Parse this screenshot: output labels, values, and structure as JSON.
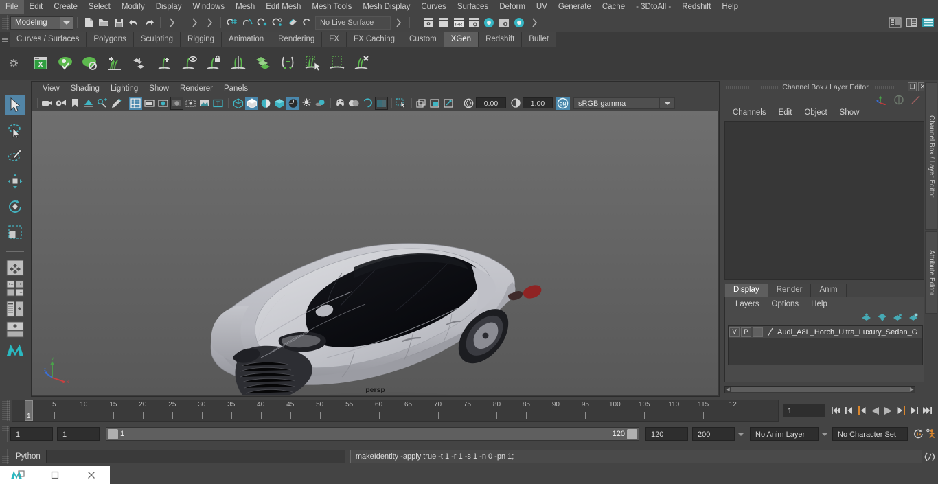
{
  "app": {
    "menubar": [
      "File",
      "Edit",
      "Create",
      "Select",
      "Modify",
      "Display",
      "Windows",
      "Mesh",
      "Edit Mesh",
      "Mesh Tools",
      "Mesh Display",
      "Curves",
      "Surfaces",
      "Deform",
      "UV",
      "Generate",
      "Cache",
      "- 3DtoAll -",
      "Redshift",
      "Help"
    ]
  },
  "statusline": {
    "menuset_value": "Modeling",
    "live_surface": "No Live Surface"
  },
  "shelf": {
    "tabs": [
      "Curves / Surfaces",
      "Polygons",
      "Sculpting",
      "Rigging",
      "Animation",
      "Rendering",
      "FX",
      "FX Caching",
      "Custom",
      "XGen",
      "Redshift",
      "Bullet"
    ],
    "active_tab": "XGen",
    "icons": [
      "xgen-editor-icon",
      "xgen-preview-visible-icon",
      "xgen-preview-disable-icon",
      "xgen-add-collection-icon",
      "xgen-import-description-icon",
      "xgen-add-description-icon",
      "xgen-preview-description-icon",
      "xgen-lock-description-icon",
      "xgen-mirror-description-icon",
      "xgen-duplicate-description-icon",
      "xgen-transfer-icon",
      "xgen-select-primitives-icon",
      "xgen-select-region-icon",
      "xgen-clear-region-icon",
      "xgen-delete-primitives-icon"
    ]
  },
  "toolbox": {
    "tools": [
      {
        "name": "select-tool",
        "selected": true
      },
      {
        "name": "lasso-select-tool",
        "selected": false
      },
      {
        "name": "paint-select-tool",
        "selected": false
      },
      {
        "name": "move-tool",
        "selected": false
      },
      {
        "name": "rotate-tool",
        "selected": false
      },
      {
        "name": "scale-tool",
        "selected": false
      }
    ],
    "layouts": [
      "single-perspective-layout",
      "four-view-layout",
      "outliner-persp-layout",
      "hypershade-persp-layout",
      "maya-logo-icon"
    ]
  },
  "viewport": {
    "menus": [
      "View",
      "Shading",
      "Lighting",
      "Show",
      "Renderer",
      "Panels"
    ],
    "exposure_value": "0.00",
    "gamma_value": "1.00",
    "color_management": "sRGB gamma",
    "color_management_toggle": "ON",
    "camera_label": "persp",
    "axis_labels": {
      "x": "x",
      "y": "y",
      "z": "z"
    },
    "toolbar_icons": [
      "select-camera-icon",
      "camera-attributes-icon",
      "bookmark-icon",
      "image-plane-icon",
      "2d-pan-zoom-icon",
      "grease-pencil-icon",
      "grid-toggle-icon",
      "film-gate-icon",
      "resolution-gate-icon",
      "gate-mask-icon",
      "film-origin-icon",
      "exposure-icon",
      "text-icon",
      "wireframe-icon",
      "smooth-shade-icon",
      "shaded-wireframe-icon",
      "flat-shade-icon",
      "textured-icon",
      "lights-icon",
      "shadows-icon",
      "screen-space-ao-icon",
      "motion-blur-icon",
      "multisample-icon",
      "depth-of-field-icon",
      "xray-icon",
      "xray-joints-icon",
      "xray-active-icon",
      "isolate-select-icon",
      "no-isolate-icon",
      "exposure-aperture-icon",
      "contrast-icon"
    ]
  },
  "channelbox": {
    "panel_title": "Channel Box / Layer Editor",
    "menus": [
      "Channels",
      "Edit",
      "Object",
      "Show"
    ],
    "layer_tabs": [
      "Display",
      "Render",
      "Anim"
    ],
    "active_layer_tab": "Display",
    "layer_menus": [
      "Layers",
      "Options",
      "Help"
    ],
    "layers": [
      {
        "visibility": "V",
        "playback": "P",
        "name": "Audi_A8L_Horch_Ultra_Luxury_Sedan_G"
      }
    ]
  },
  "vertical_tabs": [
    "Channel Box / Layer Editor",
    "Attribute Editor"
  ],
  "timeline": {
    "start": 1,
    "end": 120,
    "current_frame": "1",
    "tick_labels": [
      "5",
      "10",
      "15",
      "20",
      "25",
      "30",
      "35",
      "40",
      "45",
      "50",
      "55",
      "60",
      "65",
      "70",
      "75",
      "80",
      "85",
      "90",
      "95",
      "100",
      "105",
      "110",
      "115",
      "12"
    ],
    "playback_buttons": [
      "go-to-start-icon",
      "step-back-keyframe-icon",
      "step-back-frame-icon",
      "play-backwards-icon",
      "play-forwards-icon",
      "step-forward-frame-icon",
      "step-forward-keyframe-icon",
      "go-to-end-icon"
    ]
  },
  "range": {
    "anim_start": "1",
    "range_start": "1",
    "slider_start": "1",
    "slider_end": "120",
    "range_end": "120",
    "anim_end": "200",
    "anim_layer": "No Anim Layer",
    "character_set": "No Character Set",
    "right_icons": [
      "animation-preferences-icon",
      "character-set-icon"
    ]
  },
  "command": {
    "language_label": "Python",
    "input_value": "",
    "output_value": "makeIdentity -apply true -t 1 -r 1 -s 1 -n 0 -pn 1;",
    "script_editor_icon": "script-editor-icon"
  },
  "taskbar": {
    "items": [
      "maya-app-icon",
      "restore-window-icon",
      "close-window-icon"
    ]
  },
  "colors": {
    "accent_blue": "#4a88ad",
    "accent_teal": "#35b6c4",
    "shelf_green": "#6cbb5a",
    "panel_bg": "#444444",
    "viewport_bg": "#636363",
    "orange": "#d08a3e"
  }
}
